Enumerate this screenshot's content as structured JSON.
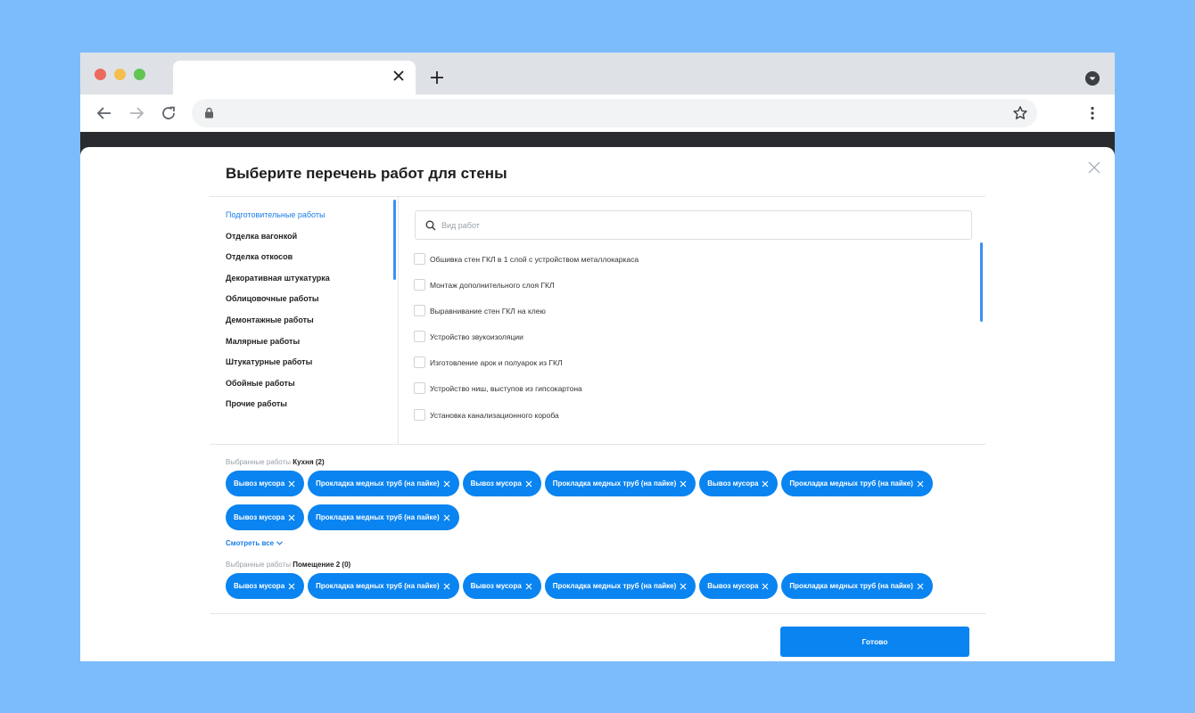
{
  "modal": {
    "title": "Выберите перечень работ для стены",
    "categories": [
      "Подготовительные работы",
      "Отделка вагонкой",
      "Отделка откосов",
      "Декоративная штукатурка",
      "Облицовочные работы",
      "Демонтажные работы",
      "Малярные работы",
      "Штукатурные работы",
      "Обойные работы",
      "Прочие работы"
    ],
    "active_category": "Подготовительные работы",
    "search": {
      "placeholder": "Вид работ",
      "value": ""
    },
    "works": [
      "Обшивка стен ГКЛ в 1 слой с устройством металлокаркаса",
      "Монтаж дополнительного слоя ГКЛ",
      "Выравнивание стен ГКЛ на клею",
      "Устройство звукоизоляции",
      "Изготовление арок и полуарок из ГКЛ",
      "Устройство ниш, выступов из гипсокартона",
      "Установка канализационного короба"
    ],
    "selected_groups": [
      {
        "prefix": "Выбранные работы",
        "room": "Кухня (2)",
        "chips": [
          "Вывоз мусора",
          "Прокладка медных труб (на пайке)",
          "Вывоз мусора",
          "Прокладка медных труб (на пайке)",
          "Вывоз мусора",
          "Прокладка медных труб (на пайке)",
          "Вывоз мусора",
          "Прокладка медных труб (на пайке)"
        ]
      },
      {
        "prefix": "Выбранные работы",
        "room": "Помещение 2 (0)",
        "chips": [
          "Вывоз мусора",
          "Прокладка медных труб (на пайке)",
          "Вывоз мусора",
          "Прокладка медных труб (на пайке)",
          "Вывоз мусора",
          "Прокладка медных труб (на пайке)"
        ]
      }
    ],
    "see_all": "Смотреть все",
    "done_label": "Готово"
  },
  "colors": {
    "background": "#7dbcfb",
    "accent": "#0a84f0",
    "active_link": "#1a7ee8"
  }
}
